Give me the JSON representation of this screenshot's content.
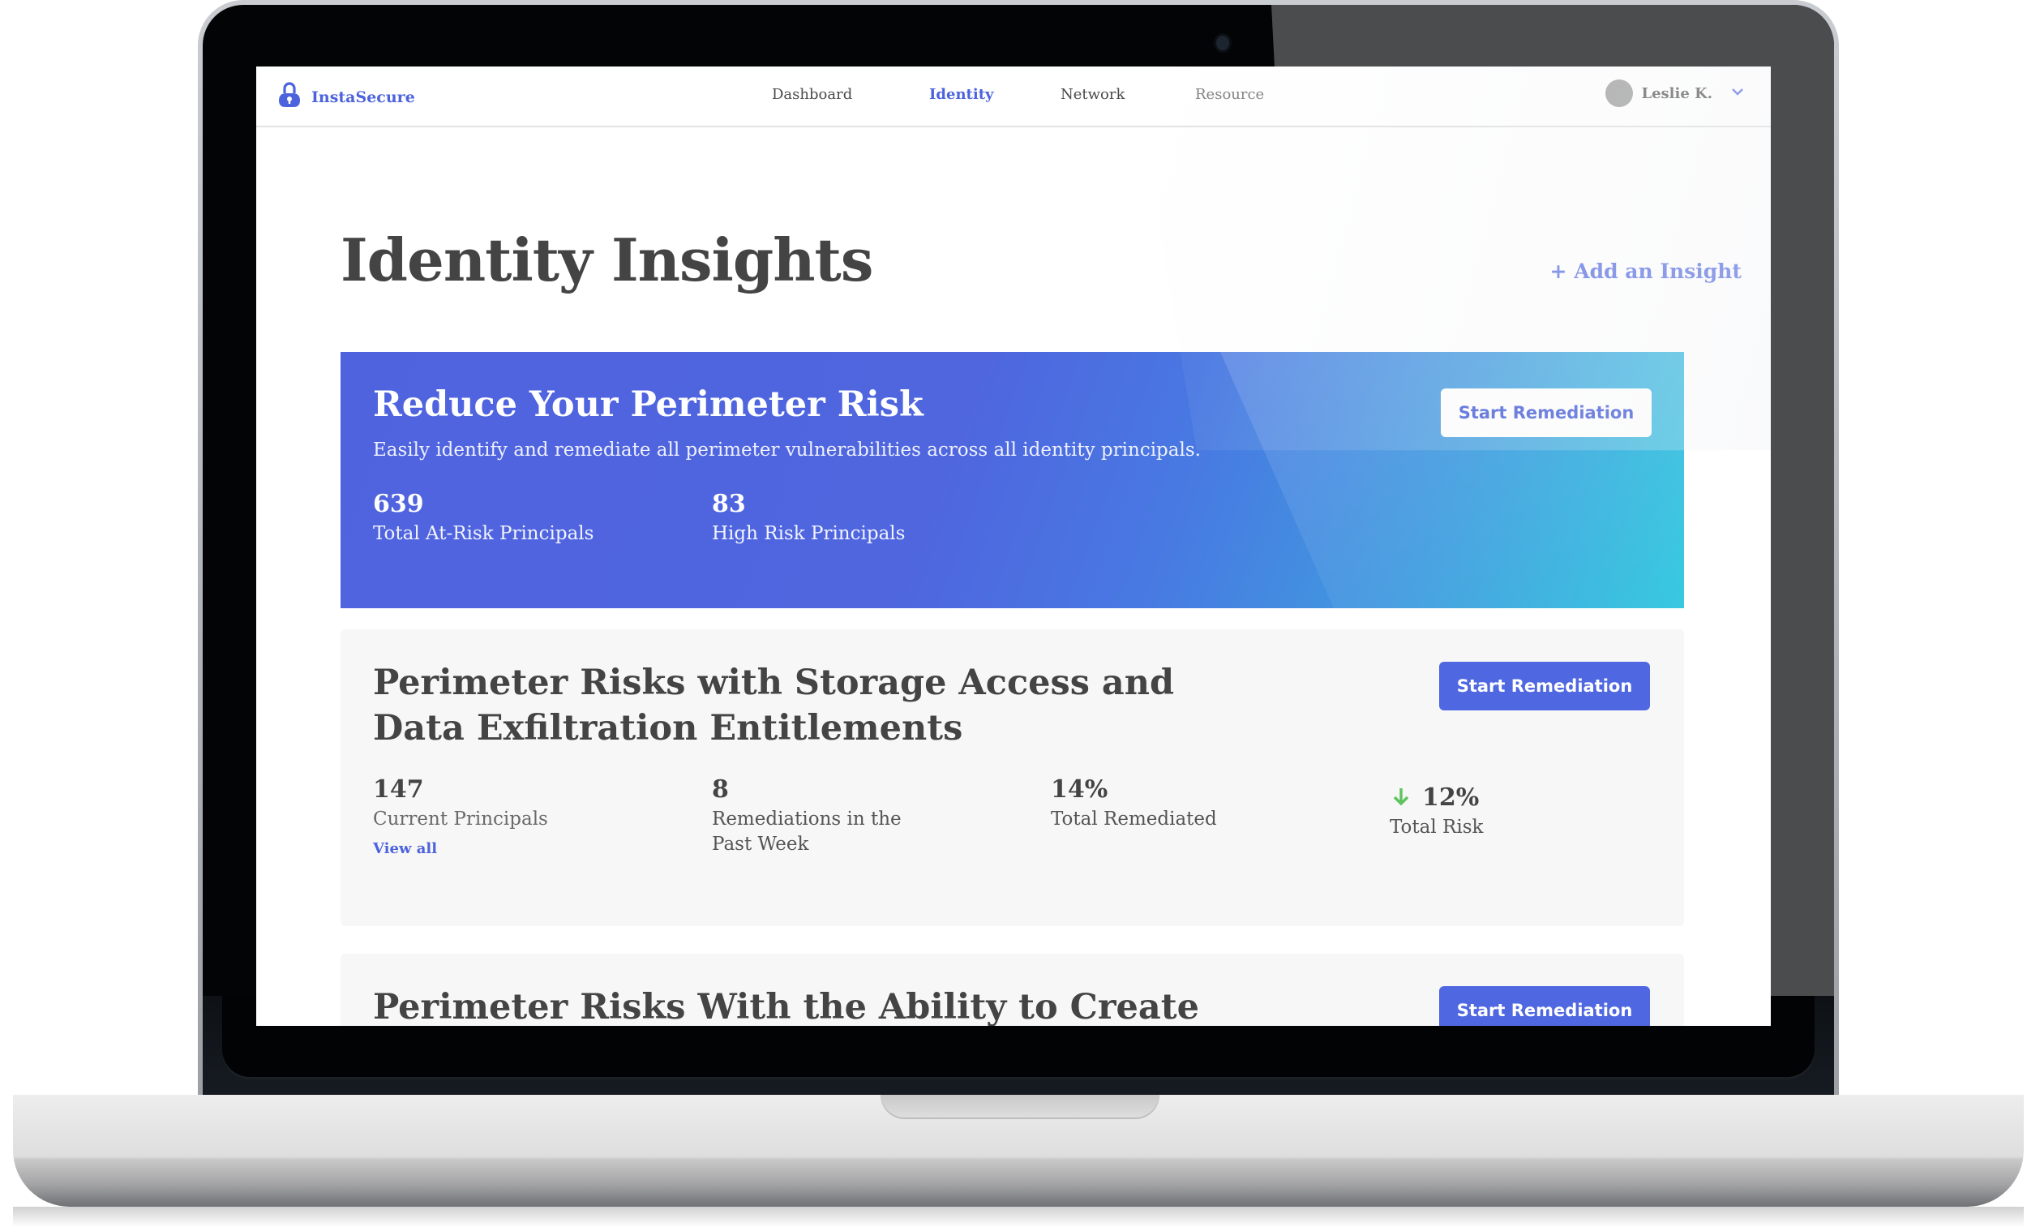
{
  "app": {
    "brand": "InstaSecure",
    "brand_icon": "padlock-icon",
    "accent_color": "#4d63dd",
    "positive_color": "#5cc45c"
  },
  "nav": {
    "items": [
      {
        "label": "Dashboard",
        "active": false
      },
      {
        "label": "Identity",
        "active": true
      },
      {
        "label": "Network",
        "active": false
      },
      {
        "label": "Resource",
        "active": false
      }
    ]
  },
  "user": {
    "name": "Leslie K.",
    "menu_icon": "chevron-down-icon"
  },
  "page": {
    "title": "Identity Insights",
    "add_insight_label": "+ Add an Insight"
  },
  "hero": {
    "title": "Reduce Your Perimeter Risk",
    "subtitle": "Easily identify and remediate all perimeter vulnerabilities across all identity principals.",
    "button_label": "Start Remediation",
    "stats": [
      {
        "value": "639",
        "label": "Total At-Risk Principals"
      },
      {
        "value": "83",
        "label": "High Risk Principals"
      }
    ]
  },
  "insights": [
    {
      "title": "Perimeter Risks with Storage Access and Data Exfiltration Entitlements",
      "button_label": "Start Remediation",
      "stats": [
        {
          "value": "147",
          "label": "Current Principals",
          "link": "View all"
        },
        {
          "value": "8",
          "label": "Remediations in the Past Week"
        },
        {
          "value": "14%",
          "label": "Total Remediated"
        },
        {
          "value": "12%",
          "label": "Total Risk",
          "trend": "down",
          "trend_icon": "arrow-down-icon"
        }
      ]
    },
    {
      "title": "Perimeter Risks With the Ability to Create",
      "button_label": "Start Remediation"
    }
  ]
}
